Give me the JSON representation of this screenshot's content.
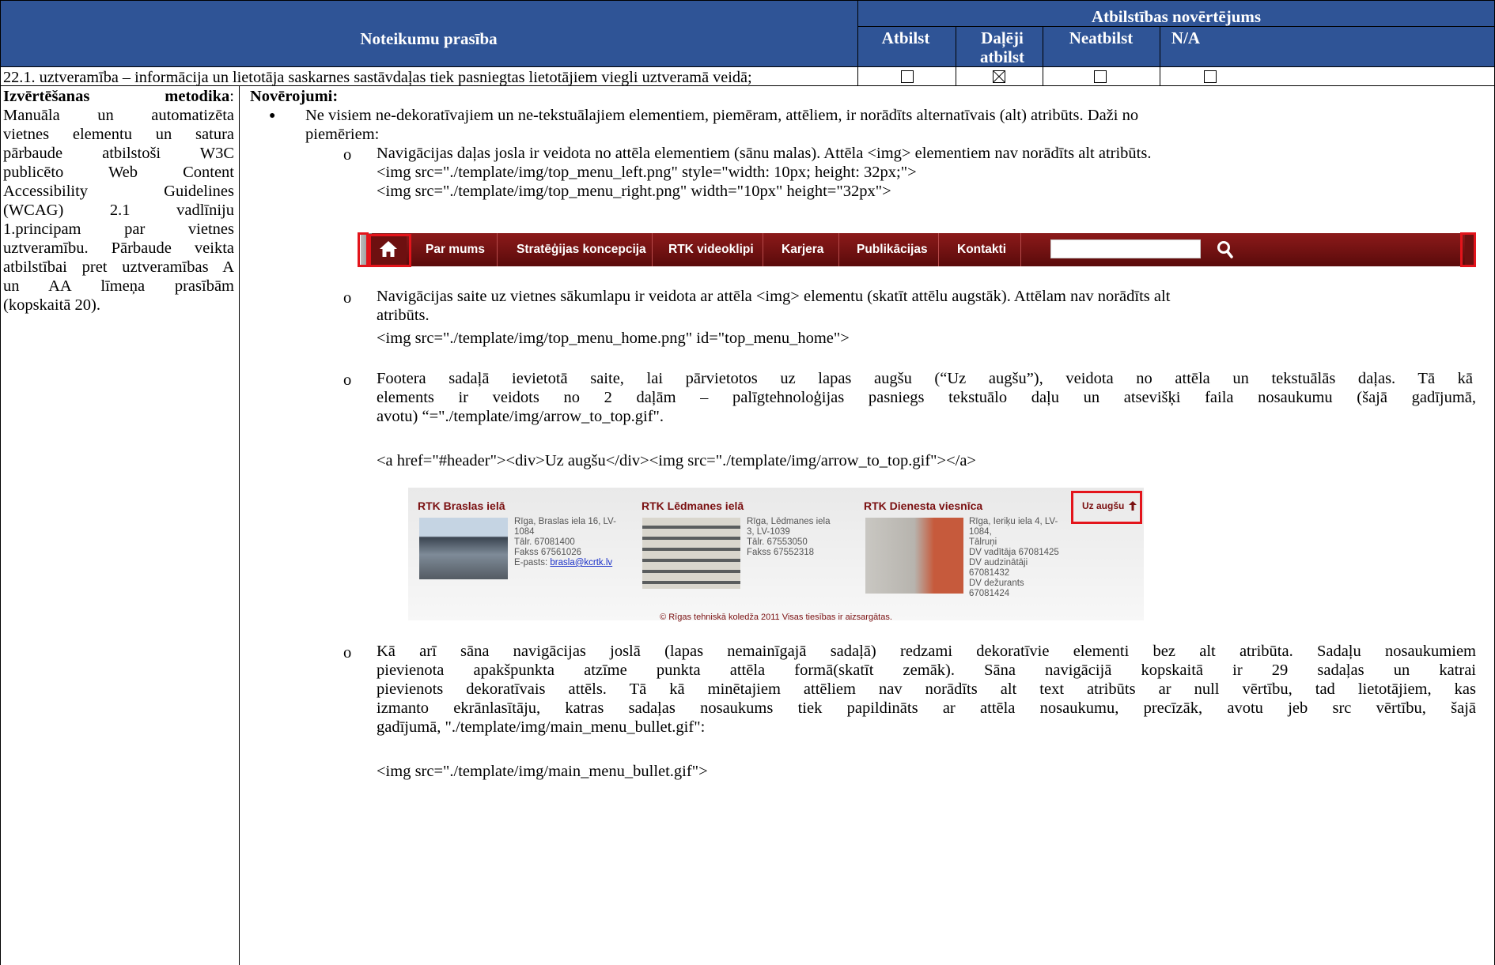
{
  "header": {
    "requirement_title": "Noteikumu prasība",
    "assessment_title": "Atbilstības novērtējums",
    "cols": [
      "Atbilst",
      "Daļēji\natbilst",
      "Neatbilst",
      "N/A"
    ]
  },
  "row": {
    "requirement": "22.1. uztveramība – informācija un lietotāja saskarnes sastāvdaļas tiek pasniegtas lietotājiem viegli uztveramā veidā;",
    "checkbox_states": [
      "☐",
      "☒",
      "☐",
      "☐"
    ]
  },
  "method": {
    "label": "Izvērtēšanas metodika",
    "lines": [
      "Manuāla un automatizēta",
      "vietnes elementu un satura",
      "pārbaude atbilstoši W3C",
      "publicēto Web Content",
      "Accessibility Guidelines",
      "(WCAG) 2.1 vadlīniju",
      "1.principam par vietnes",
      "uztveramību. Pārbaude veikta",
      "atbilstībai pret uztveramības A",
      "un AA līmeņa prasībām"
    ],
    "last_line": "(kopskaitā 20)."
  },
  "observations": {
    "label": "Novērojumi:",
    "bullet_line1": "Ne visiem ne-dekoratīvajiem un ne-tekstuālajiem elementiem, piemēram, attēliem, ir norādīts alternatīvais (alt) atribūts. Daži no",
    "bullet_line2": "piemēriem:",
    "item1_text": "Navigācijas daļas josla ir veidota no attēla elementiem (sānu malas). Attēla <img> elementiem nav norādīts alt atribūts.",
    "item1_code1": "<img src=\"./template/img/top_menu_left.png\" style=\"width: 10px; height: 32px;\">",
    "item1_code2": "<img src=\"./template/img/top_menu_right.png\" width=\"10px\" height=\"32px\">",
    "item2_line1": "Navigācijas saite uz vietnes sākumlapu ir veidota ar attēla <img> elementu (skatīt attēlu augstāk). Attēlam nav norādīts alt",
    "item2_line2": "atribūts.",
    "item2_code": "<img src=\"./template/img/top_menu_home.png\" id=\"top_menu_home\">",
    "item3_line1": "Footera sadaļā ievietotā saite, lai pārvietotos uz lapas augšu (“Uz augšu”), veidota no attēla un tekstuālās daļas. Tā kā",
    "item3_line2": "elements ir veidots no 2 daļām – palīgtehnoloģijas pasniegs tekstuālo daļu un atsevišķi faila nosaukumu (šajā gadījumā,",
    "item3_line3": "avotu) “=\"./template/img/arrow_to_top.gif\".",
    "item3_code": "<a href=\"#header\"><div>Uz augšu</div><img src=\"./template/img/arrow_to_top.gif\"></a>",
    "item4_line1": "Kā arī sāna navigācijas joslā (lapas nemainīgajā sadaļā) redzami dekoratīvie elementi bez alt atribūta. Sadaļu nosaukumiem",
    "item4_line2": "pievienota apakšpunkta atzīme punkta attēla formā(skatīt zemāk). Sāna navigācijā kopskaitā ir 29 sadaļas un katrai",
    "item4_line3": "pievienots dekoratīvais attēls. Tā kā minētajiem attēliem nav norādīts alt text atribūts ar null vērtību, tad lietotājiem, kas",
    "item4_line4": "izmanto ekrānlasītāju, katras sadaļas nosaukums tiek papildināts ar attēla nosaukumu, precīzāk, avotu jeb src vērtību, šajā",
    "item4_line5": "gadījumā, \"./template/img/main_menu_bullet.gif\":",
    "item4_code": "<img src=\"./template/img/main_menu_bullet.gif\">"
  },
  "navbar": {
    "items": [
      "Par mums",
      "Stratēģijas koncepcija",
      "RTK videoklipi",
      "Karjera",
      "Publikācijas",
      "Kontakti"
    ],
    "icons": [
      "home-icon",
      "search-icon"
    ]
  },
  "footer_shot": {
    "col1": {
      "title": "RTK Braslas ielā",
      "addr": [
        "Rīga, Braslas iela 16, LV-",
        "1084",
        "Tālr. 67081400",
        "Fakss 67561026"
      ],
      "email_label": "E-pasts: ",
      "email": "brasla@kcrtk.lv"
    },
    "col2": {
      "title": "RTK Lēdmanes ielā",
      "addr": [
        "Rīga, Lēdmanes iela",
        "3, LV-1039",
        "Tālr. 67553050",
        "Fakss 67552318"
      ]
    },
    "col3": {
      "title": "RTK Dienesta viesnīca",
      "addr": [
        "Rīga, Ieriķu iela 4, LV-",
        "1084,",
        "Tālruņi",
        "DV vadītāja 67081425",
        "DV audzinātāji",
        "67081432",
        "DV dežurants",
        "67081424"
      ]
    },
    "to_top": "Uz augšu",
    "copyright": "© Rīgas tehniskā koledža 2011 Visas tiesības ir aizsargātas."
  }
}
